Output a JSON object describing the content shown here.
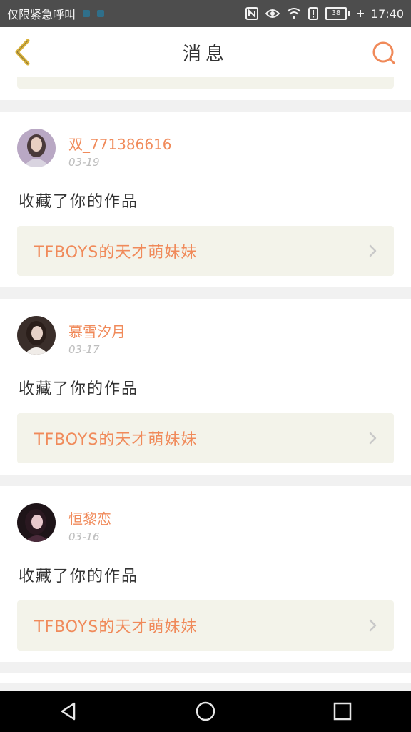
{
  "status_bar": {
    "carrier_text": "仅限紧急呼叫",
    "battery_level": "38",
    "time": "17:40",
    "icons": [
      "nfc-icon",
      "eye-icon",
      "wifi-icon",
      "alert-icon",
      "battery-icon",
      "charging-icon"
    ]
  },
  "header": {
    "title": "消息",
    "back_icon": "chevron-left-icon",
    "search_icon": "search-icon"
  },
  "colors": {
    "accent": "#f08a5a",
    "back_icon": "#d9b23a",
    "link_bg": "#f3f3ea",
    "page_bg": "#f1f1f1"
  },
  "notifications": [
    {
      "username": "双_771386616",
      "date": "03-19",
      "action": "收藏了你的作品",
      "work_title": "TFBOYS的天才萌妹妹"
    },
    {
      "username": "慕雪汐月",
      "date": "03-17",
      "action": "收藏了你的作品",
      "work_title": "TFBOYS的天才萌妹妹"
    },
    {
      "username": "恒黎恋",
      "date": "03-16",
      "action": "收藏了你的作品",
      "work_title": "TFBOYS的天才萌妹妹"
    }
  ],
  "nav_bar": {
    "buttons": [
      "back-triangle-icon",
      "home-circle-icon",
      "recents-square-icon"
    ]
  }
}
